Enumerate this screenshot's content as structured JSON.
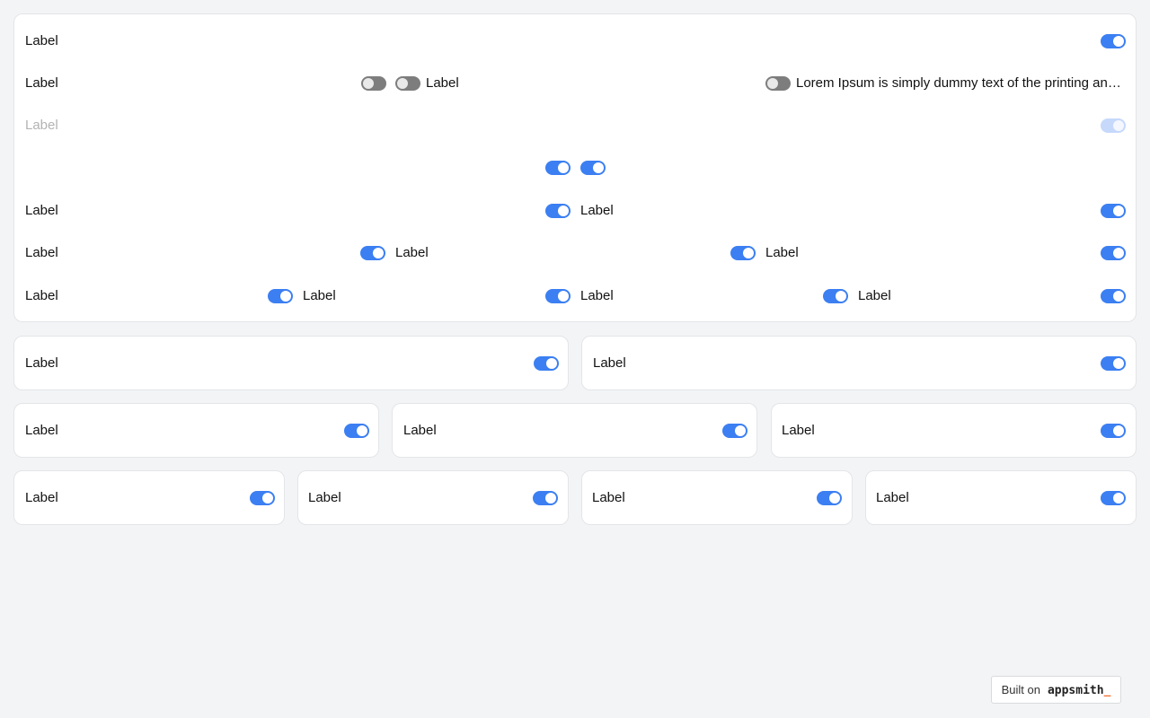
{
  "main_card": {
    "rows": [
      {
        "labels": [
          "Label"
        ],
        "toggles": [
          "on"
        ]
      },
      {
        "labels": [
          "Label",
          "Label",
          "Lorem Ipsum is simply dummy text of the printing and typesetting industry"
        ],
        "toggles": [
          "off",
          "off",
          "off"
        ]
      },
      {
        "labels": [
          "Label"
        ],
        "toggles": [
          "disabled"
        ]
      },
      {
        "labels": [],
        "toggles": [
          "on",
          "on"
        ]
      },
      {
        "labels": [
          "Label",
          "Label"
        ],
        "toggles": [
          "on",
          "on"
        ]
      },
      {
        "labels": [
          "Label",
          "Label",
          "Label"
        ],
        "toggles": [
          "on",
          "on",
          "on"
        ]
      },
      {
        "labels": [
          "Label",
          "Label",
          "Label",
          "Label"
        ],
        "toggles": [
          "on",
          "on",
          "on",
          "on"
        ]
      }
    ]
  },
  "two_col": [
    {
      "label": "Label",
      "toggle": "on"
    },
    {
      "label": "Label",
      "toggle": "on"
    }
  ],
  "three_col": [
    {
      "label": "Label",
      "toggle": "on"
    },
    {
      "label": "Label",
      "toggle": "on"
    },
    {
      "label": "Label",
      "toggle": "on"
    }
  ],
  "four_col": [
    {
      "label": "Label",
      "toggle": "on"
    },
    {
      "label": "Label",
      "toggle": "on"
    },
    {
      "label": "Label",
      "toggle": "on"
    },
    {
      "label": "Label",
      "toggle": "on"
    }
  ],
  "footer": {
    "built_on": "Built on",
    "brand": "appsmith",
    "cursor": "_"
  },
  "colors": {
    "accent": "#3b7ff2",
    "off": "#7d7d7d",
    "background": "#f3f4f6"
  }
}
